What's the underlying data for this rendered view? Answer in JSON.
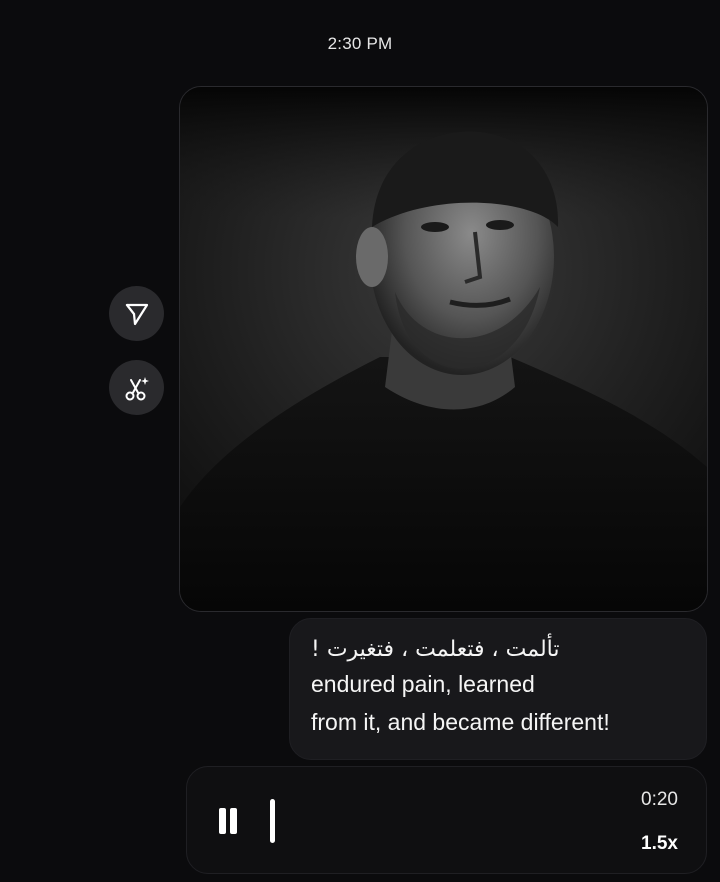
{
  "chat": {
    "timestamp": "2:30 PM"
  },
  "media": {
    "description": "image"
  },
  "actions": {
    "share_icon": "paper-plane-icon",
    "remix_icon": "scissors-sparkle-icon"
  },
  "caption_message": {
    "arabic": "تألمت ، فتعلمت ، فتغيرت !",
    "english_line1": "endured pain, learned",
    "english_line2": "from it, and became different!"
  },
  "voice_message": {
    "play_state_icon": "pause-icon",
    "duration": "0:20",
    "speed": "1.5x"
  },
  "colors": {
    "background": "#0b0b0d",
    "bubble": "#18181b",
    "button": "#2a2a2d"
  }
}
